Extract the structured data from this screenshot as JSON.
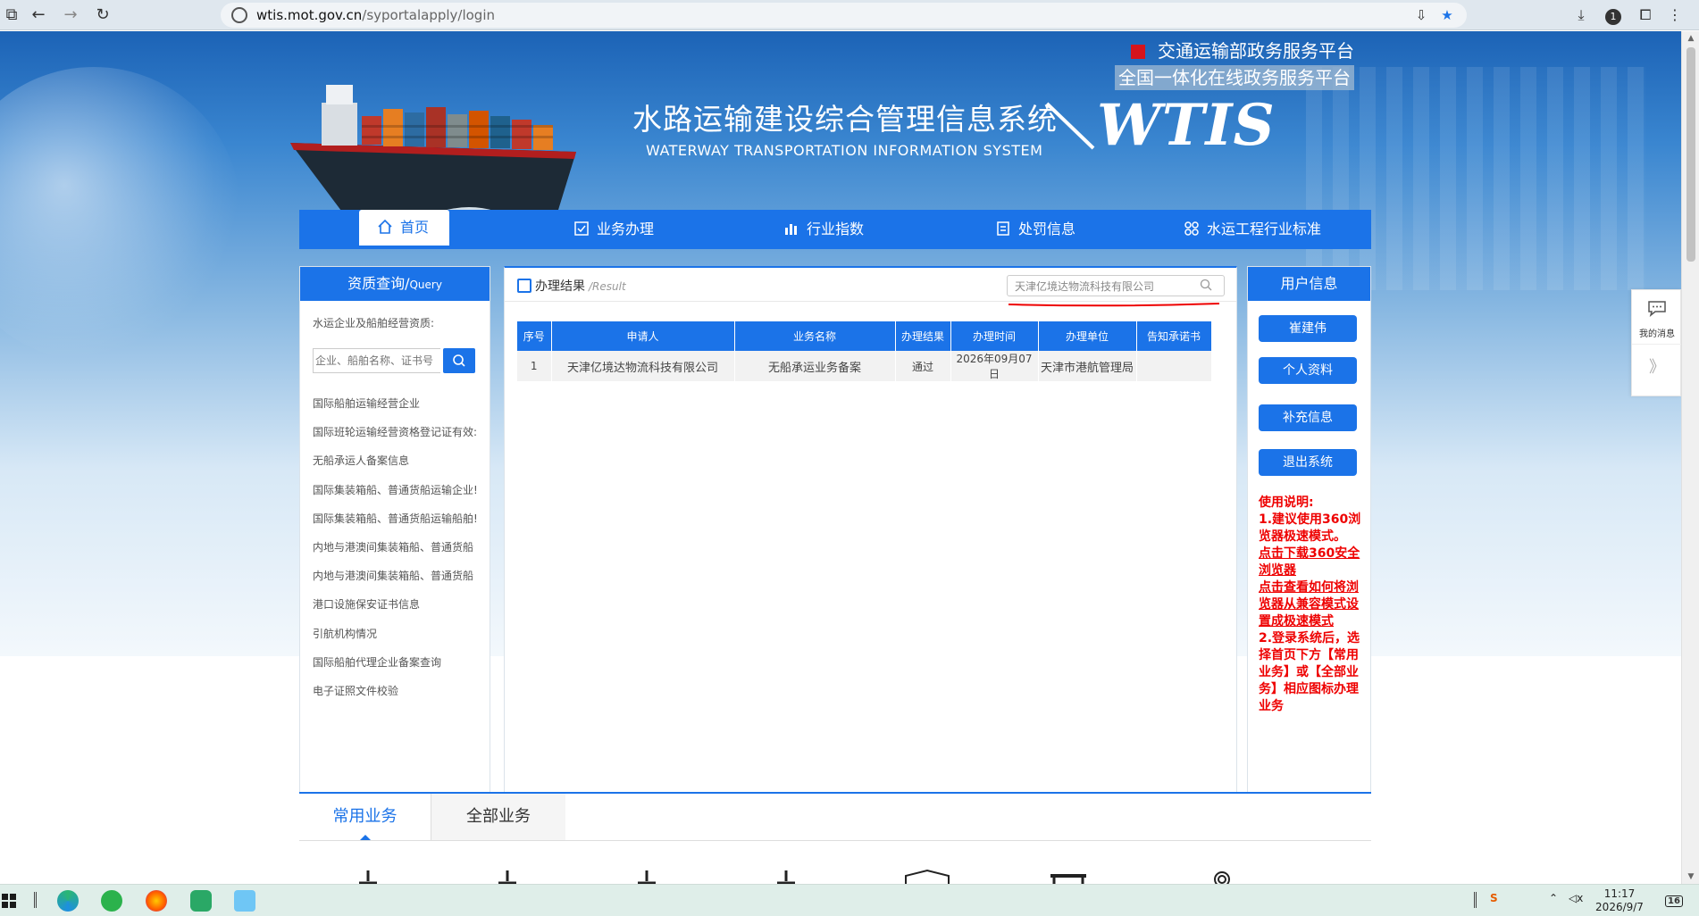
{
  "browser": {
    "url_host": "wtis.mot.gov.cn",
    "url_path": "/syportalapply/login",
    "extension_badge": "1"
  },
  "header": {
    "platform_line1": "交通运输部政务服务平台",
    "platform_line2": "全国一体化在线政务服务平台",
    "system_title_cn": "水路运输建设综合管理信息系统",
    "system_title_en": "WATERWAY TRANSPORTATION INFORMATION SYSTEM",
    "logo": "WTIS"
  },
  "nav": {
    "items": [
      {
        "label": "首页",
        "icon": "home-icon"
      },
      {
        "label": "业务办理",
        "icon": "checklist-icon"
      },
      {
        "label": "行业指数",
        "icon": "bar-chart-icon"
      },
      {
        "label": "处罚信息",
        "icon": "document-icon"
      },
      {
        "label": "水运工程行业标准",
        "icon": "grid-icon"
      }
    ]
  },
  "left_panel": {
    "title": "资质查询/",
    "title_en": "Query",
    "label": "水运企业及船舶经营资质:",
    "search_placeholder": "企业、船舶名称、证书号（",
    "links": [
      "国际船舶运输经营企业",
      "国际班轮运输经营资格登记证有效:",
      "无船承运人备案信息",
      "国际集装箱船、普通货船运输企业!",
      "国际集装箱船、普通货船运输船舶!",
      "内地与港澳间集装箱船、普通货船",
      "内地与港澳间集装箱船、普通货船",
      "港口设施保安证书信息",
      "引航机构情况",
      "国际船舶代理企业备案查询",
      "电子证照文件校验"
    ]
  },
  "result": {
    "title": "办理结果",
    "title_en": "/Result",
    "search_value": "天津亿境达物流科技有限公司",
    "columns": [
      "序号",
      "申请人",
      "业务名称",
      "办理结果",
      "办理时间",
      "办理单位",
      "告知承诺书"
    ],
    "rows": [
      [
        "1",
        "天津亿境达物流科技有限公司",
        "无船承运业务备案",
        "通过",
        "2026年09月07日",
        "天津市港航管理局",
        ""
      ]
    ]
  },
  "user_panel": {
    "title": "用户信息",
    "buttons": [
      "崔建伟",
      "个人资料",
      "补充信息",
      "退出系统"
    ],
    "usage_title": "使用说明:",
    "usage_1": "1.建议使用360浏览器极速模式。",
    "usage_link1": "点击下载360安全浏览器",
    "usage_link2": "点击查看如何将浏览器从兼容模式设置成极速模式",
    "usage_2": "2.登录系统后，选择首页下方【常用业务】或【全部业务】相应图标办理业务"
  },
  "bottom": {
    "tabs": [
      "常用业务",
      "全部业务"
    ]
  },
  "float_widget": {
    "label": "我的消息",
    "collapse": "》"
  },
  "taskbar": {
    "time": "11:17",
    "date": "2026/9/7",
    "notification_count": "16"
  },
  "colors": {
    "primary": "#1b73e8",
    "alert_red": "#e00000",
    "brand_red": "#d6141b"
  }
}
